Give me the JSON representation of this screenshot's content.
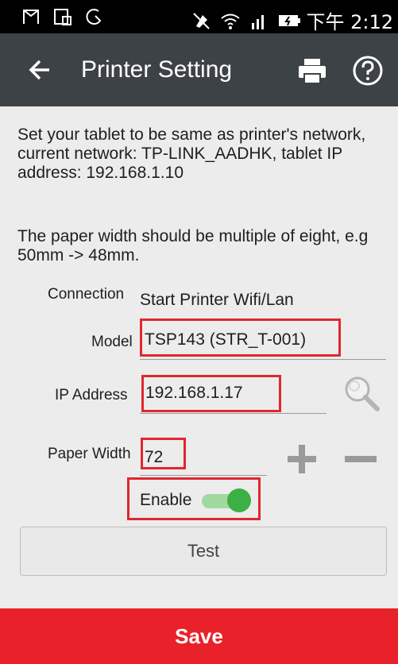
{
  "status_bar": {
    "time": "下午 2:12"
  },
  "app_bar": {
    "title": "Printer Setting",
    "back_icon": "arrow-left-icon",
    "print_icon": "printer-icon",
    "help_icon": "help-circle-icon"
  },
  "description": {
    "network_text": "Set your tablet to be same as printer's network, current network: TP-LINK_AADHK, tablet IP address: 192.168.1.10",
    "paper_text": "The paper width should be multiple of eight, e.g 50mm -> 48mm."
  },
  "form": {
    "connection_label": "Connection",
    "connection_value": "Start Printer Wifi/Lan",
    "model_label": "Model",
    "model_value": "TSP143 (STR_T-001)",
    "ip_label": "IP Address",
    "ip_value": "192.168.1.17",
    "paper_width_label": "Paper Width",
    "paper_width_value": "72",
    "enable_label": "Enable",
    "enable_on": true
  },
  "buttons": {
    "test_label": "Test",
    "save_label": "Save"
  },
  "colors": {
    "app_bar": "#3d4247",
    "highlight": "#e0272f",
    "save": "#e8212a",
    "toggle_on": "#3cb043"
  }
}
